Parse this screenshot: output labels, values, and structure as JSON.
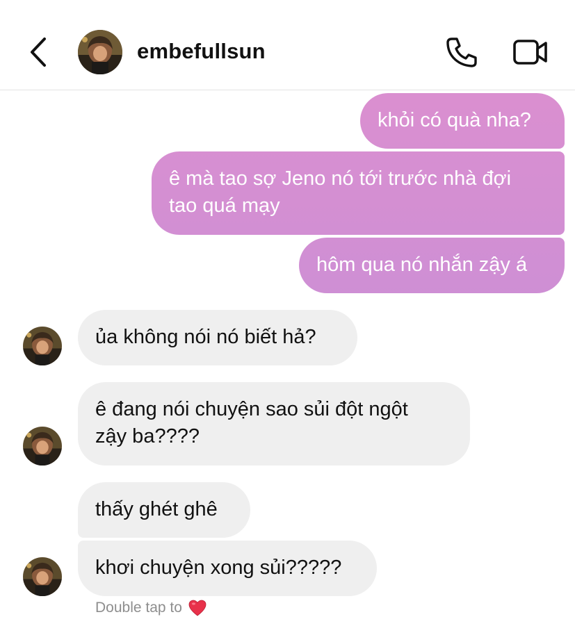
{
  "header": {
    "username": "embefullsun",
    "icons": {
      "back": "chevron-left-icon",
      "call": "phone-icon",
      "video": "video-camera-icon"
    }
  },
  "colors": {
    "sent_gradient_top": "#e08fce",
    "sent_gradient_bottom": "#c08be0",
    "received_bubble": "#efefef",
    "hint_text": "#8e8e8e",
    "heart": "#e8314a"
  },
  "messages": [
    {
      "from": "me",
      "text": "khỏi có quà nha?"
    },
    {
      "from": "me",
      "text": "ê mà tao sợ Jeno nó tới trước nhà đợi tao quá mạy"
    },
    {
      "from": "me",
      "text": "hôm qua nó nhắn zậy á"
    },
    {
      "from": "them",
      "text": "ủa không nói nó biết hả?"
    },
    {
      "from": "them",
      "text": "ê đang nói chuyện sao sủi đột ngột zậy ba????"
    },
    {
      "from": "them",
      "text": "thấy ghét ghê"
    },
    {
      "from": "them",
      "text": "khơi chuyện xong sủi?????"
    }
  ],
  "sent_lines": {
    "m1": [
      "ê mà tao sợ Jeno nó tới trước nhà đợi",
      "tao quá mạy"
    ]
  },
  "recv_lines": {
    "m4": [
      "ê đang nói chuyện sao sủi đột ngột",
      "zậy ba????"
    ]
  },
  "reaction_hint": {
    "text": "Double tap to",
    "icon": "heart-emoji-icon"
  }
}
